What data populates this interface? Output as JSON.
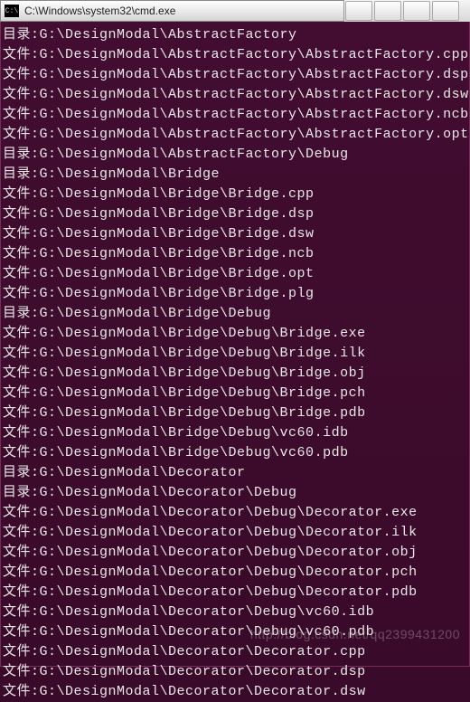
{
  "window": {
    "icon_label": "C:\\",
    "title": "C:\\Windows\\system32\\cmd.exe"
  },
  "labels": {
    "dir": "目录:  ",
    "file": "文件:  "
  },
  "lines": [
    {
      "type": "dir",
      "path": "G:\\DesignModal\\AbstractFactory"
    },
    {
      "type": "file",
      "path": "G:\\DesignModal\\AbstractFactory\\AbstractFactory.cpp"
    },
    {
      "type": "file",
      "path": "G:\\DesignModal\\AbstractFactory\\AbstractFactory.dsp"
    },
    {
      "type": "file",
      "path": "G:\\DesignModal\\AbstractFactory\\AbstractFactory.dsw"
    },
    {
      "type": "file",
      "path": "G:\\DesignModal\\AbstractFactory\\AbstractFactory.ncb"
    },
    {
      "type": "file",
      "path": "G:\\DesignModal\\AbstractFactory\\AbstractFactory.opt"
    },
    {
      "type": "dir",
      "path": "G:\\DesignModal\\AbstractFactory\\Debug"
    },
    {
      "type": "dir",
      "path": "G:\\DesignModal\\Bridge"
    },
    {
      "type": "file",
      "path": "G:\\DesignModal\\Bridge\\Bridge.cpp"
    },
    {
      "type": "file",
      "path": "G:\\DesignModal\\Bridge\\Bridge.dsp"
    },
    {
      "type": "file",
      "path": "G:\\DesignModal\\Bridge\\Bridge.dsw"
    },
    {
      "type": "file",
      "path": "G:\\DesignModal\\Bridge\\Bridge.ncb"
    },
    {
      "type": "file",
      "path": "G:\\DesignModal\\Bridge\\Bridge.opt"
    },
    {
      "type": "file",
      "path": "G:\\DesignModal\\Bridge\\Bridge.plg"
    },
    {
      "type": "dir",
      "path": "G:\\DesignModal\\Bridge\\Debug"
    },
    {
      "type": "file",
      "path": "G:\\DesignModal\\Bridge\\Debug\\Bridge.exe"
    },
    {
      "type": "file",
      "path": "G:\\DesignModal\\Bridge\\Debug\\Bridge.ilk"
    },
    {
      "type": "file",
      "path": "G:\\DesignModal\\Bridge\\Debug\\Bridge.obj"
    },
    {
      "type": "file",
      "path": "G:\\DesignModal\\Bridge\\Debug\\Bridge.pch"
    },
    {
      "type": "file",
      "path": "G:\\DesignModal\\Bridge\\Debug\\Bridge.pdb"
    },
    {
      "type": "file",
      "path": "G:\\DesignModal\\Bridge\\Debug\\vc60.idb"
    },
    {
      "type": "file",
      "path": "G:\\DesignModal\\Bridge\\Debug\\vc60.pdb"
    },
    {
      "type": "dir",
      "path": "G:\\DesignModal\\Decorator"
    },
    {
      "type": "dir",
      "path": "G:\\DesignModal\\Decorator\\Debug"
    },
    {
      "type": "file",
      "path": "G:\\DesignModal\\Decorator\\Debug\\Decorator.exe"
    },
    {
      "type": "file",
      "path": "G:\\DesignModal\\Decorator\\Debug\\Decorator.ilk"
    },
    {
      "type": "file",
      "path": "G:\\DesignModal\\Decorator\\Debug\\Decorator.obj"
    },
    {
      "type": "file",
      "path": "G:\\DesignModal\\Decorator\\Debug\\Decorator.pch"
    },
    {
      "type": "file",
      "path": "G:\\DesignModal\\Decorator\\Debug\\Decorator.pdb"
    },
    {
      "type": "file",
      "path": "G:\\DesignModal\\Decorator\\Debug\\vc60.idb"
    },
    {
      "type": "file",
      "path": "G:\\DesignModal\\Decorator\\Debug\\vc60.pdb"
    },
    {
      "type": "file",
      "path": "G:\\DesignModal\\Decorator\\Decorator.cpp"
    },
    {
      "type": "file",
      "path": "G:\\DesignModal\\Decorator\\Decorator.dsp"
    },
    {
      "type": "file",
      "path": "G:\\DesignModal\\Decorator\\Decorator.dsw"
    }
  ],
  "watermark": "http://blog.csdn.net/qq2399431200"
}
